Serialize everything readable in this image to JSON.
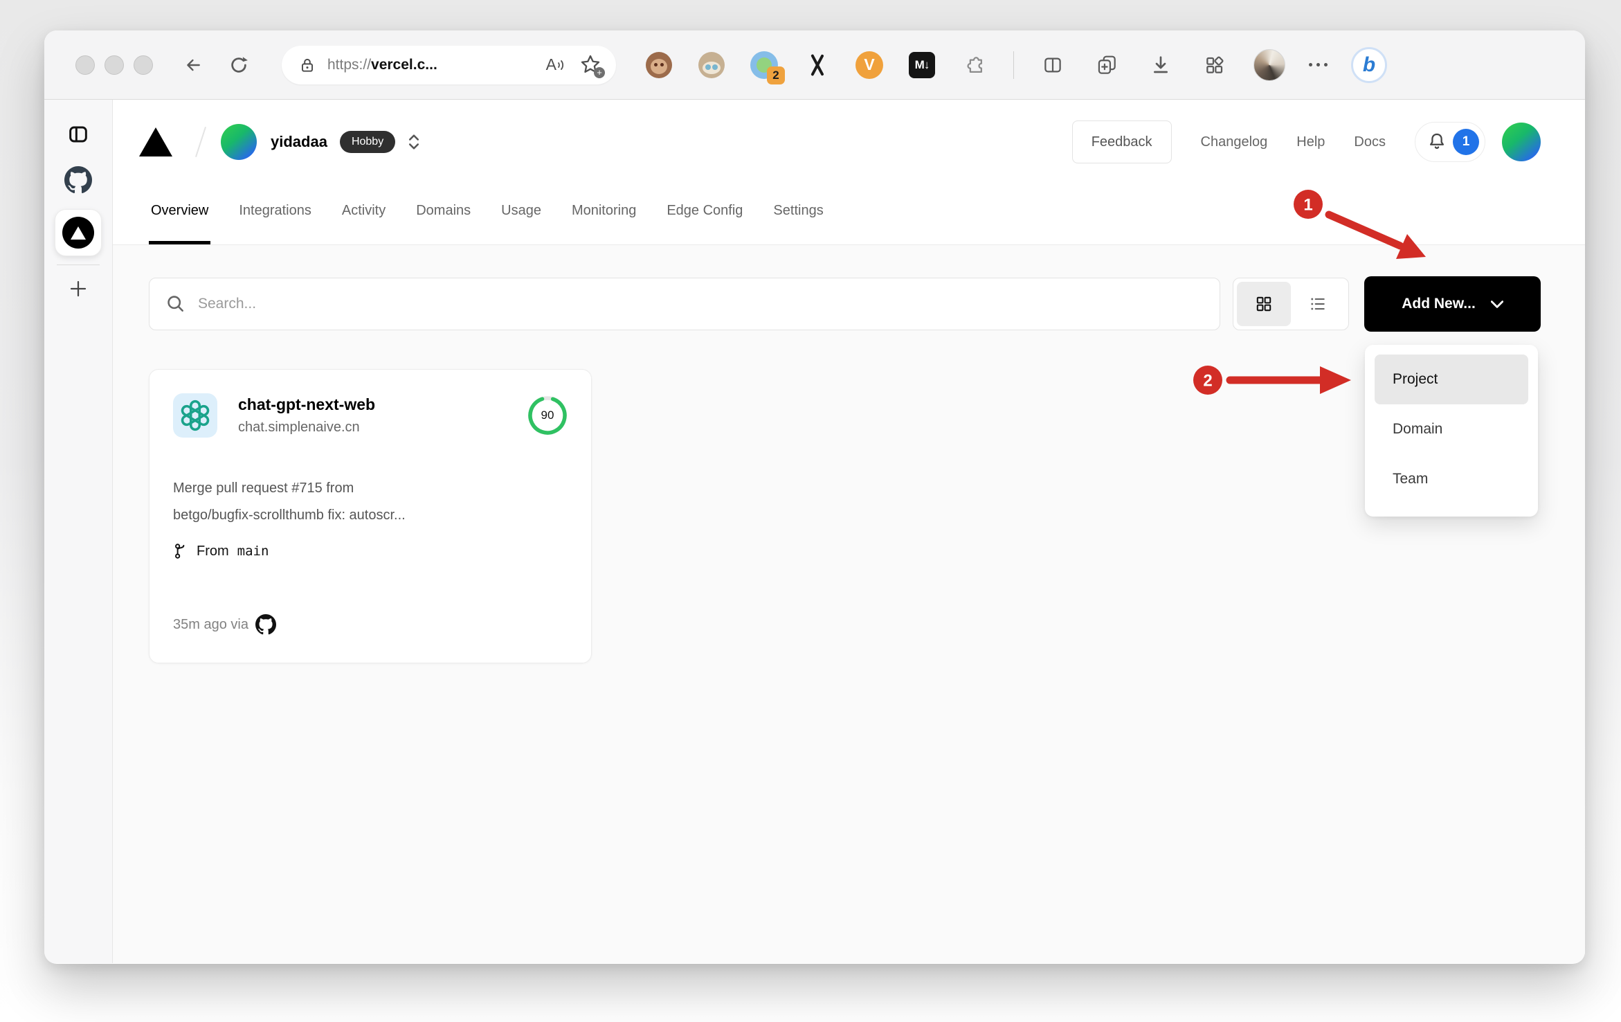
{
  "browser": {
    "url": {
      "scheme": "https://",
      "host": "vercel.c..."
    },
    "read_aloud_letter": "A",
    "extensions": {
      "badge_count": "2",
      "v_label": "V",
      "md_label": "M↓"
    },
    "bing_label": "b"
  },
  "vc_header": {
    "team_name": "yidadaa",
    "plan_badge": "Hobby",
    "feedback": "Feedback",
    "changelog": "Changelog",
    "help": "Help",
    "docs": "Docs",
    "notification_count": "1"
  },
  "tabs": [
    {
      "label": "Overview"
    },
    {
      "label": "Integrations"
    },
    {
      "label": "Activity"
    },
    {
      "label": "Domains"
    },
    {
      "label": "Usage"
    },
    {
      "label": "Monitoring"
    },
    {
      "label": "Edge Config"
    },
    {
      "label": "Settings"
    }
  ],
  "controls": {
    "search_placeholder": "Search...",
    "add_new": "Add New..."
  },
  "add_menu": {
    "items": [
      "Project",
      "Domain",
      "Team"
    ],
    "highlighted": "Project"
  },
  "project_card": {
    "name": "chat-gpt-next-web",
    "domain": "chat.simplenaive.cn",
    "score": "90",
    "commit_line1": "Merge pull request #715 from",
    "commit_line2": "betgo/bugfix-scrollthumb fix: autoscr...",
    "branch_label": "From",
    "branch_name": "main",
    "deploy_meta": "35m ago via"
  },
  "annotations": {
    "step1": "1",
    "step2": "2"
  },
  "colors": {
    "annotation_red": "#d22d26",
    "score_green": "#2fc162",
    "badge_blue": "#2173e8",
    "openai_teal": "#1aa38b",
    "accent_black": "#000000"
  }
}
